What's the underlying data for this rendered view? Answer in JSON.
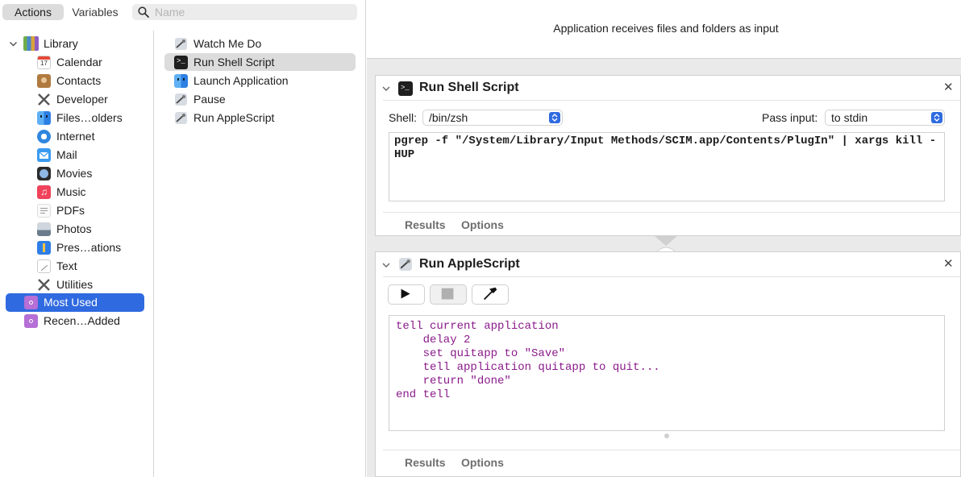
{
  "toolbar": {
    "actions_tab": "Actions",
    "variables_tab": "Variables",
    "search_placeholder": "Name"
  },
  "library": {
    "root_label": "Library",
    "categories": [
      {
        "label": "Calendar",
        "icon": "calendar-icon"
      },
      {
        "label": "Contacts",
        "icon": "contacts-icon"
      },
      {
        "label": "Developer",
        "icon": "developer-icon"
      },
      {
        "label": "Files…olders",
        "icon": "finder-icon"
      },
      {
        "label": "Internet",
        "icon": "internet-icon"
      },
      {
        "label": "Mail",
        "icon": "mail-icon"
      },
      {
        "label": "Movies",
        "icon": "movies-icon"
      },
      {
        "label": "Music",
        "icon": "music-icon"
      },
      {
        "label": "PDFs",
        "icon": "pdf-icon"
      },
      {
        "label": "Photos",
        "icon": "photos-icon"
      },
      {
        "label": "Pres…ations",
        "icon": "keynote-icon"
      },
      {
        "label": "Text",
        "icon": "text-icon"
      },
      {
        "label": "Utilities",
        "icon": "utilities-icon"
      }
    ],
    "smart_groups": [
      {
        "label": "Most Used",
        "icon": "smart-folder-icon",
        "selected": true
      },
      {
        "label": "Recen…Added",
        "icon": "smart-folder-icon",
        "selected": false
      }
    ]
  },
  "actions": [
    {
      "label": "Watch Me Do",
      "icon": "automator-icon"
    },
    {
      "label": "Run Shell Script",
      "icon": "terminal-icon",
      "selected": true
    },
    {
      "label": "Launch Application",
      "icon": "finder-icon"
    },
    {
      "label": "Pause",
      "icon": "automator-icon"
    },
    {
      "label": "Run AppleScript",
      "icon": "automator-icon"
    }
  ],
  "workflow": {
    "header": "Application receives files and folders as input",
    "shell_card": {
      "title": "Run Shell Script",
      "shell_label": "Shell:",
      "shell_value": "/bin/zsh",
      "pass_input_label": "Pass input:",
      "pass_input_value": "to stdin",
      "code": "pgrep -f \"/System/Library/Input Methods/SCIM.app/Contents/PlugIn\" | xargs kill -HUP",
      "results_tab": "Results",
      "options_tab": "Options"
    },
    "applescript_card": {
      "title": "Run AppleScript",
      "code": "tell current application\n    delay 2\n    set quitapp to \"Save\"\n    tell application quitapp to quit...\n    return \"done\"\nend tell",
      "results_tab": "Results",
      "options_tab": "Options"
    }
  },
  "colors": {
    "accent": "#2f6ae0",
    "applescript_text": "#8a1a8a"
  }
}
